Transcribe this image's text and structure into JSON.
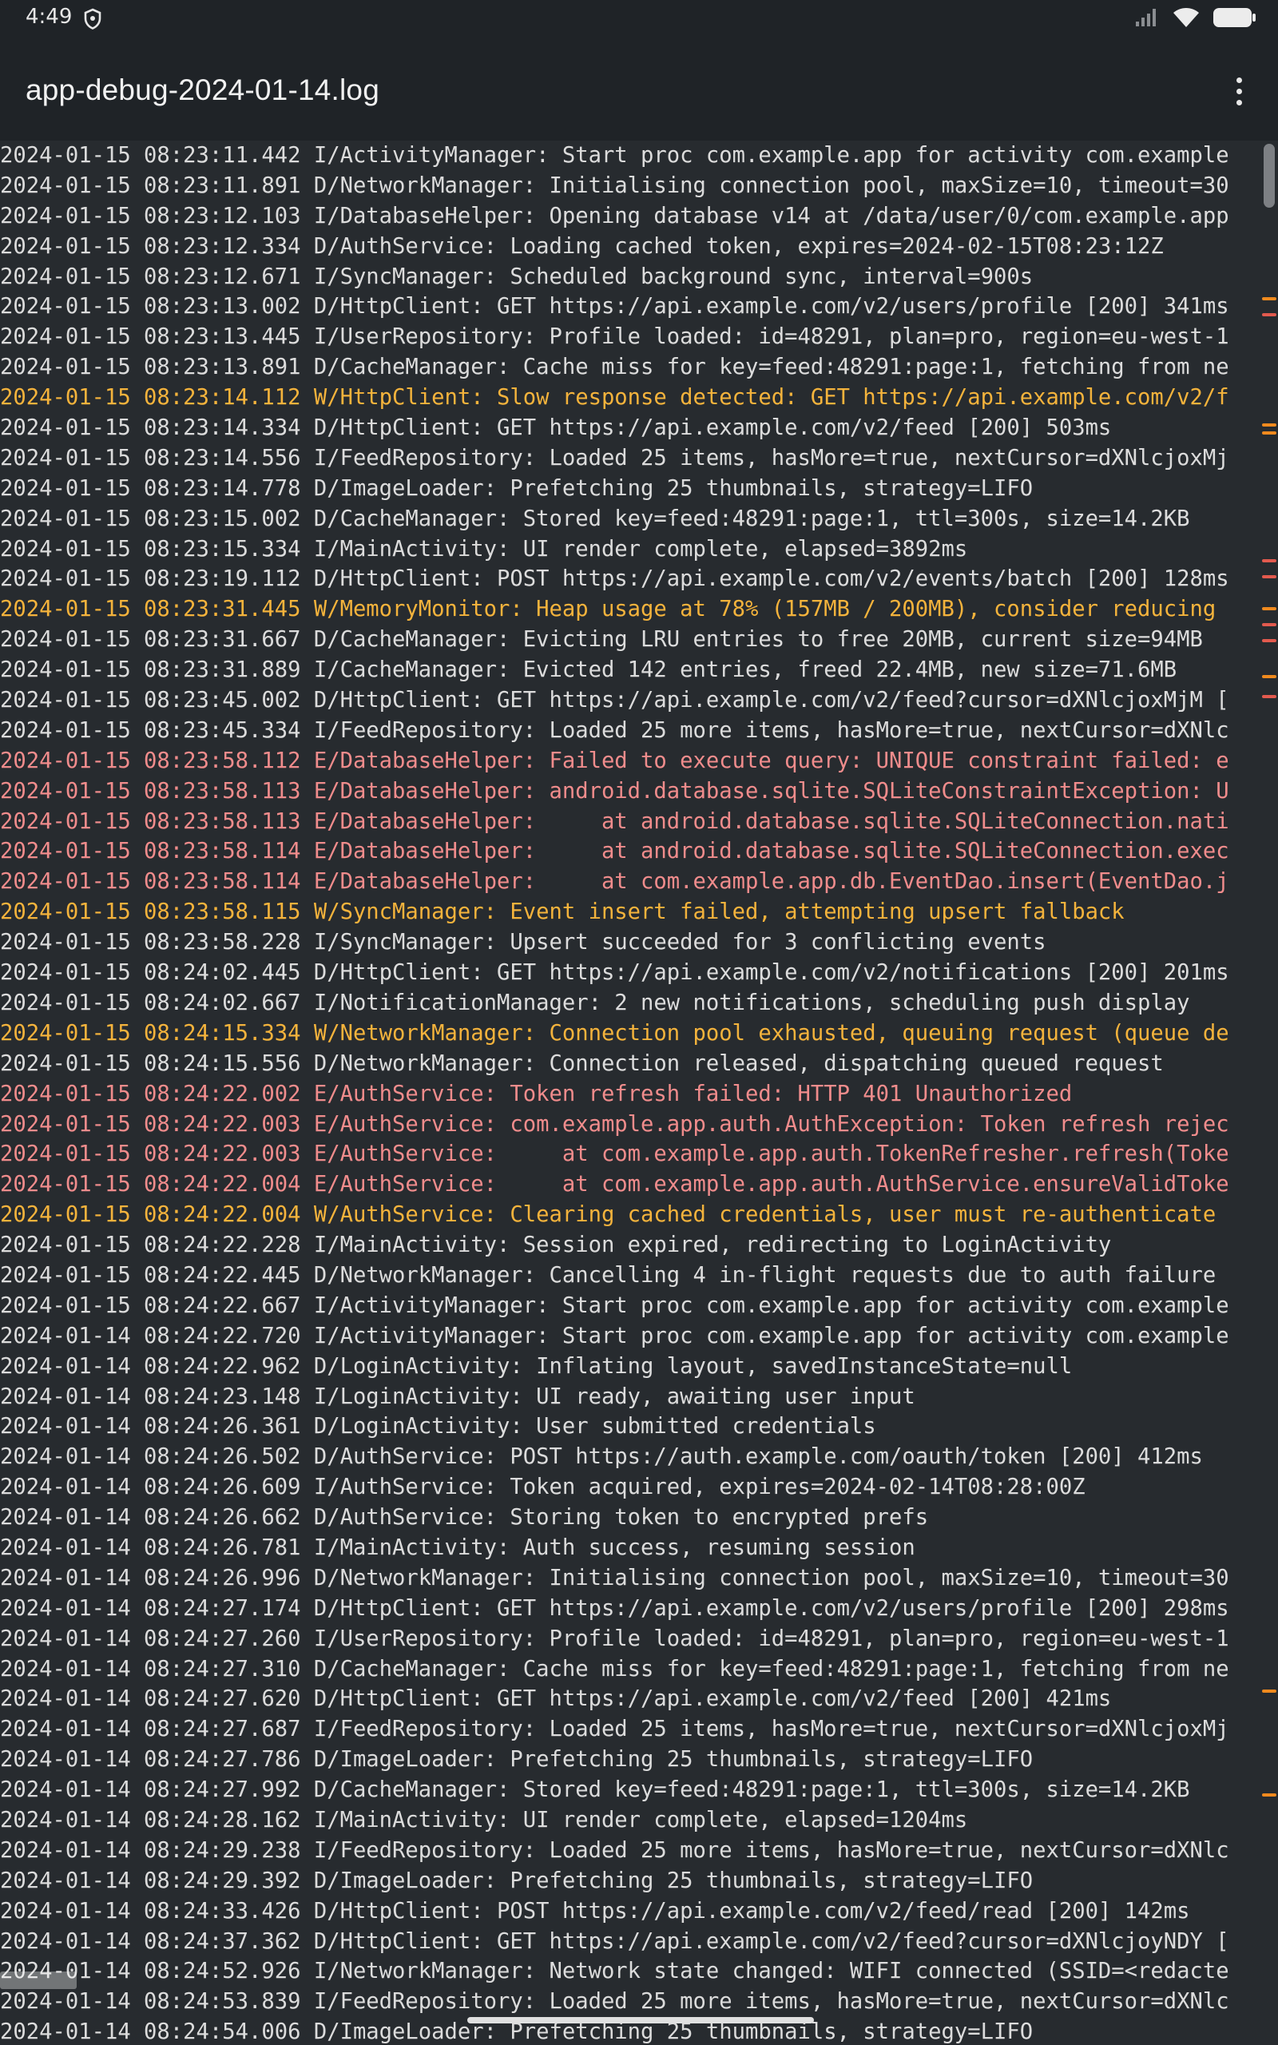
{
  "statusbar": {
    "time": "4:49"
  },
  "appbar": {
    "title": "app-debug-2024-01-14.log"
  },
  "log_lines": [
    {
      "text": "2024-01-15 08:23:11.442 I/ActivityManager: Start proc com.example.app for activity com.example",
      "level": "I"
    },
    {
      "text": "2024-01-15 08:23:11.891 D/NetworkManager: Initialising connection pool, maxSize=10, timeout=30",
      "level": "D"
    },
    {
      "text": "2024-01-15 08:23:12.103 I/DatabaseHelper: Opening database v14 at /data/user/0/com.example.app",
      "level": "I"
    },
    {
      "text": "2024-01-15 08:23:12.334 D/AuthService: Loading cached token, expires=2024-02-15T08:23:12Z",
      "level": "D"
    },
    {
      "text": "2024-01-15 08:23:12.671 I/SyncManager: Scheduled background sync, interval=900s",
      "level": "I"
    },
    {
      "text": "2024-01-15 08:23:13.002 D/HttpClient: GET https://api.example.com/v2/users/profile [200] 341ms",
      "level": "D"
    },
    {
      "text": "2024-01-15 08:23:13.445 I/UserRepository: Profile loaded: id=48291, plan=pro, region=eu-west-1",
      "level": "I"
    },
    {
      "text": "2024-01-15 08:23:13.891 D/CacheManager: Cache miss for key=feed:48291:page:1, fetching from ne",
      "level": "D"
    },
    {
      "text": "2024-01-15 08:23:14.112 W/HttpClient: Slow response detected: GET https://api.example.com/v2/f",
      "level": "W"
    },
    {
      "text": "2024-01-15 08:23:14.334 D/HttpClient: GET https://api.example.com/v2/feed [200] 503ms",
      "level": "D"
    },
    {
      "text": "2024-01-15 08:23:14.556 I/FeedRepository: Loaded 25 items, hasMore=true, nextCursor=dXNlcjoxMj",
      "level": "I"
    },
    {
      "text": "2024-01-15 08:23:14.778 D/ImageLoader: Prefetching 25 thumbnails, strategy=LIFO",
      "level": "D"
    },
    {
      "text": "2024-01-15 08:23:15.002 D/CacheManager: Stored key=feed:48291:page:1, ttl=300s, size=14.2KB",
      "level": "D"
    },
    {
      "text": "2024-01-15 08:23:15.334 I/MainActivity: UI render complete, elapsed=3892ms",
      "level": "I"
    },
    {
      "text": "2024-01-15 08:23:19.112 D/HttpClient: POST https://api.example.com/v2/events/batch [200] 128ms",
      "level": "D"
    },
    {
      "text": "2024-01-15 08:23:31.445 W/MemoryMonitor: Heap usage at 78% (157MB / 200MB), consider reducing",
      "level": "W"
    },
    {
      "text": "2024-01-15 08:23:31.667 D/CacheManager: Evicting LRU entries to free 20MB, current size=94MB",
      "level": "D"
    },
    {
      "text": "2024-01-15 08:23:31.889 I/CacheManager: Evicted 142 entries, freed 22.4MB, new size=71.6MB",
      "level": "I"
    },
    {
      "text": "2024-01-15 08:23:45.002 D/HttpClient: GET https://api.example.com/v2/feed?cursor=dXNlcjoxMjM [",
      "level": "D"
    },
    {
      "text": "2024-01-15 08:23:45.334 I/FeedRepository: Loaded 25 more items, hasMore=true, nextCursor=dXNlc",
      "level": "I"
    },
    {
      "text": "2024-01-15 08:23:58.112 E/DatabaseHelper: Failed to execute query: UNIQUE constraint failed: e",
      "level": "E"
    },
    {
      "text": "2024-01-15 08:23:58.113 E/DatabaseHelper: android.database.sqlite.SQLiteConstraintException: U",
      "level": "E"
    },
    {
      "text": "2024-01-15 08:23:58.113 E/DatabaseHelper:     at android.database.sqlite.SQLiteConnection.nati",
      "level": "E"
    },
    {
      "text": "2024-01-15 08:23:58.114 E/DatabaseHelper:     at android.database.sqlite.SQLiteConnection.exec",
      "level": "E"
    },
    {
      "text": "2024-01-15 08:23:58.114 E/DatabaseHelper:     at com.example.app.db.EventDao.insert(EventDao.j",
      "level": "E"
    },
    {
      "text": "2024-01-15 08:23:58.115 W/SyncManager: Event insert failed, attempting upsert fallback",
      "level": "W"
    },
    {
      "text": "2024-01-15 08:23:58.228 I/SyncManager: Upsert succeeded for 3 conflicting events",
      "level": "I"
    },
    {
      "text": "2024-01-15 08:24:02.445 D/HttpClient: GET https://api.example.com/v2/notifications [200] 201ms",
      "level": "D"
    },
    {
      "text": "2024-01-15 08:24:02.667 I/NotificationManager: 2 new notifications, scheduling push display",
      "level": "I"
    },
    {
      "text": "2024-01-15 08:24:15.334 W/NetworkManager: Connection pool exhausted, queuing request (queue de",
      "level": "W"
    },
    {
      "text": "2024-01-15 08:24:15.556 D/NetworkManager: Connection released, dispatching queued request",
      "level": "D"
    },
    {
      "text": "2024-01-15 08:24:22.002 E/AuthService: Token refresh failed: HTTP 401 Unauthorized",
      "level": "E"
    },
    {
      "text": "2024-01-15 08:24:22.003 E/AuthService: com.example.app.auth.AuthException: Token refresh rejec",
      "level": "E"
    },
    {
      "text": "2024-01-15 08:24:22.003 E/AuthService:     at com.example.app.auth.TokenRefresher.refresh(Toke",
      "level": "E"
    },
    {
      "text": "2024-01-15 08:24:22.004 E/AuthService:     at com.example.app.auth.AuthService.ensureValidToke",
      "level": "E"
    },
    {
      "text": "2024-01-15 08:24:22.004 W/AuthService: Clearing cached credentials, user must re-authenticate",
      "level": "W"
    },
    {
      "text": "2024-01-15 08:24:22.228 I/MainActivity: Session expired, redirecting to LoginActivity",
      "level": "I"
    },
    {
      "text": "2024-01-15 08:24:22.445 D/NetworkManager: Cancelling 4 in-flight requests due to auth failure",
      "level": "D"
    },
    {
      "text": "2024-01-15 08:24:22.667 I/ActivityManager: Start proc com.example.app for activity com.example",
      "level": "I"
    },
    {
      "text": "2024-01-14 08:24:22.720 I/ActivityManager: Start proc com.example.app for activity com.example",
      "level": "I"
    },
    {
      "text": "2024-01-14 08:24:22.962 D/LoginActivity: Inflating layout, savedInstanceState=null",
      "level": "D"
    },
    {
      "text": "2024-01-14 08:24:23.148 I/LoginActivity: UI ready, awaiting user input",
      "level": "I"
    },
    {
      "text": "2024-01-14 08:24:26.361 D/LoginActivity: User submitted credentials",
      "level": "D"
    },
    {
      "text": "2024-01-14 08:24:26.502 D/AuthService: POST https://auth.example.com/oauth/token [200] 412ms",
      "level": "D"
    },
    {
      "text": "2024-01-14 08:24:26.609 I/AuthService: Token acquired, expires=2024-02-14T08:28:00Z",
      "level": "I"
    },
    {
      "text": "2024-01-14 08:24:26.662 D/AuthService: Storing token to encrypted prefs",
      "level": "D"
    },
    {
      "text": "2024-01-14 08:24:26.781 I/MainActivity: Auth success, resuming session",
      "level": "I"
    },
    {
      "text": "2024-01-14 08:24:26.996 D/NetworkManager: Initialising connection pool, maxSize=10, timeout=30",
      "level": "D"
    },
    {
      "text": "2024-01-14 08:24:27.174 D/HttpClient: GET https://api.example.com/v2/users/profile [200] 298ms",
      "level": "D"
    },
    {
      "text": "2024-01-14 08:24:27.260 I/UserRepository: Profile loaded: id=48291, plan=pro, region=eu-west-1",
      "level": "I"
    },
    {
      "text": "2024-01-14 08:24:27.310 D/CacheManager: Cache miss for key=feed:48291:page:1, fetching from ne",
      "level": "D"
    },
    {
      "text": "2024-01-14 08:24:27.620 D/HttpClient: GET https://api.example.com/v2/feed [200] 421ms",
      "level": "D"
    },
    {
      "text": "2024-01-14 08:24:27.687 I/FeedRepository: Loaded 25 items, hasMore=true, nextCursor=dXNlcjoxMj",
      "level": "I"
    },
    {
      "text": "2024-01-14 08:24:27.786 D/ImageLoader: Prefetching 25 thumbnails, strategy=LIFO",
      "level": "D"
    },
    {
      "text": "2024-01-14 08:24:27.992 D/CacheManager: Stored key=feed:48291:page:1, ttl=300s, size=14.2KB",
      "level": "D"
    },
    {
      "text": "2024-01-14 08:24:28.162 I/MainActivity: UI render complete, elapsed=1204ms",
      "level": "I"
    },
    {
      "text": "2024-01-14 08:24:29.238 I/FeedRepository: Loaded 25 more items, hasMore=true, nextCursor=dXNlc",
      "level": "I"
    },
    {
      "text": "2024-01-14 08:24:29.392 D/ImageLoader: Prefetching 25 thumbnails, strategy=LIFO",
      "level": "D"
    },
    {
      "text": "2024-01-14 08:24:33.426 D/HttpClient: POST https://api.example.com/v2/feed/read [200] 142ms",
      "level": "D"
    },
    {
      "text": "2024-01-14 08:24:37.362 D/HttpClient: GET https://api.example.com/v2/feed?cursor=dXNlcjoyNDY [",
      "level": "D"
    },
    {
      "text": "2024-01-14 08:24:52.926 I/NetworkManager: Network state changed: WIFI connected (SSID=<redacte",
      "level": "I"
    },
    {
      "text": "2024-01-14 08:24:53.839 I/FeedRepository: Loaded 25 more items, hasMore=true, nextCursor=dXNlc",
      "level": "I"
    },
    {
      "text": "2024-01-14 08:24:54.006 D/ImageLoader: Prefetching 25 thumbnails, strategy=LIFO",
      "level": "D"
    }
  ],
  "colors": {
    "info_debug": "#dcdcdc",
    "warning": "#f4b33c",
    "error": "#f08c8c",
    "background": "#272b2f",
    "appbar": "#1f2327"
  }
}
